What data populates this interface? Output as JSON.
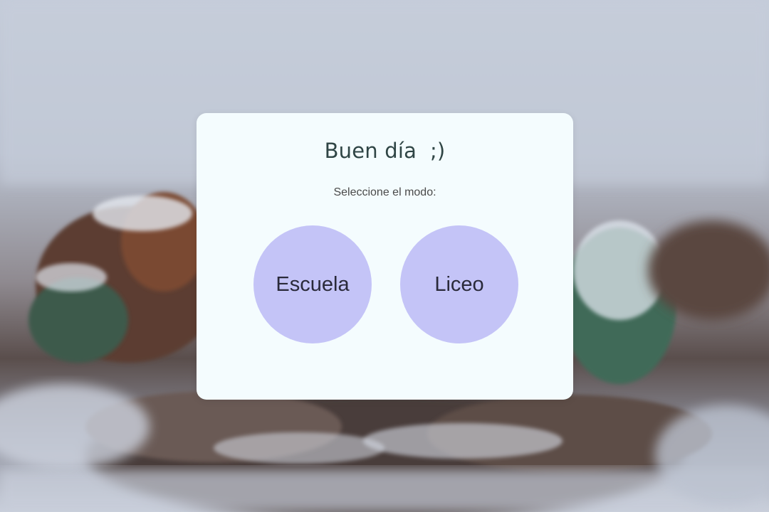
{
  "dialog": {
    "title": "Buen día  ;)",
    "subtitle": "Seleccione el modo:"
  },
  "modes": {
    "escuela_label": "Escuela",
    "liceo_label": "Liceo"
  },
  "colors": {
    "card_background": "#f4fcfe",
    "button_background": "#c4c4f7",
    "title_color": "#2f4545"
  }
}
